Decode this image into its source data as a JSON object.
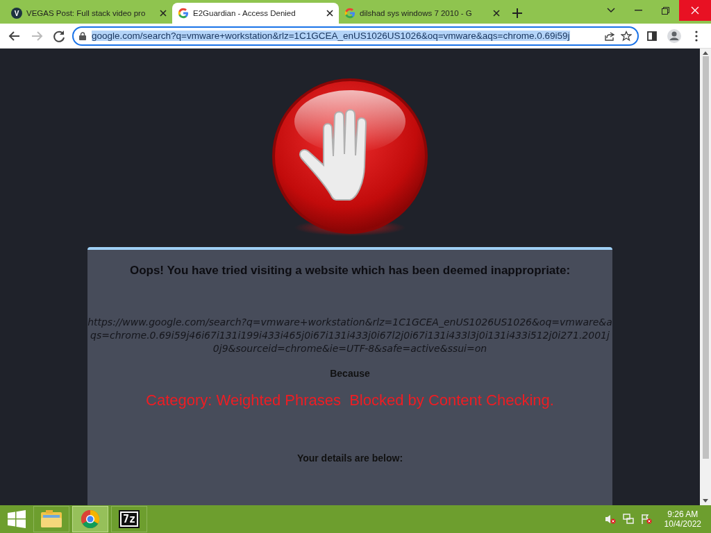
{
  "browser": {
    "tabs": [
      {
        "title": "VEGAS Post: Full stack video pro",
        "favicon": "V",
        "selected": false
      },
      {
        "title": "E2Guardian - Access Denied",
        "selected": true
      },
      {
        "title": "dilshad sys windows 7 2010 - G",
        "selected": false
      }
    ],
    "address": "google.com/search?q=vmware+workstation&rlz=1C1GCEA_enUS1026US1026&oq=vmware&aqs=chrome.0.69i59j"
  },
  "page": {
    "heading": "Oops! You have tried visiting a website which has been deemed inappropriate:",
    "url": "https://www.google.com/search?q=vmware+workstation&rlz=1C1GCEA_enUS1026US1026&oq=vmware&aqs=chrome.0.69i59j46i67i131i199i433i465j0i67i131i433j0i67l2j0i67i131i433l3j0i131i433i512j0i271.2001j0j9&sourceid=chrome&ie=UTF-8&safe=active&ssui=on",
    "because": "Because",
    "reason": "Category: Weighted Phrases  Blocked by Content Checking.",
    "details": "Your details are below:"
  },
  "taskbar": {
    "apps": [
      {
        "kind": "explorer",
        "selected": false
      },
      {
        "kind": "chrome",
        "selected": true
      },
      {
        "kind": "sevenzip",
        "label": "7z",
        "selected": false
      }
    ],
    "time": "9:26 AM",
    "date": "10/4/2022"
  }
}
